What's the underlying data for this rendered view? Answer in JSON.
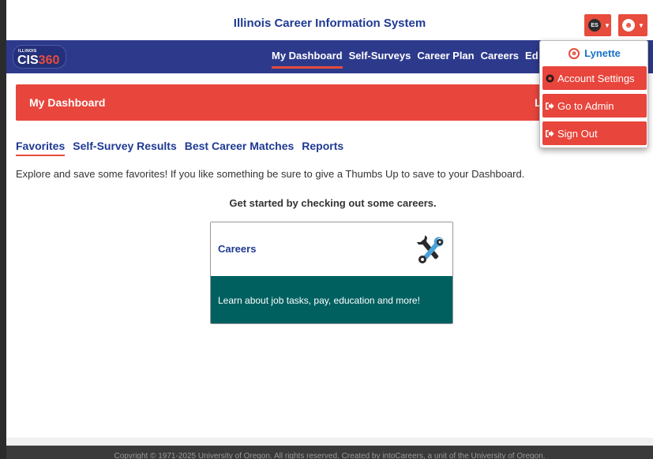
{
  "header": {
    "title": "Illinois Career Information System",
    "lang_badge": "ES",
    "accent_color": "#e74c3c",
    "brand_color": "#2d3a8c"
  },
  "logo": {
    "small_text": "ILLINOIS",
    "brand": "CIS",
    "number": "360"
  },
  "nav": {
    "items": [
      {
        "label": "My Dashboard",
        "active": true
      },
      {
        "label": "Self-Surveys"
      },
      {
        "label": "Career Plan"
      },
      {
        "label": "Careers"
      },
      {
        "label": "Ed"
      }
    ]
  },
  "banner": {
    "title": "My Dashboard",
    "right_text": "L"
  },
  "subtabs": [
    {
      "label": "Favorites",
      "active": true
    },
    {
      "label": "Self-Survey Results"
    },
    {
      "label": "Best Career Matches"
    },
    {
      "label": "Reports"
    }
  ],
  "main": {
    "intro": "Explore and save some favorites! If you like something be sure to give a Thumbs Up to save to your Dashboard.",
    "get_started": "Get started by checking out some careers."
  },
  "card": {
    "title": "Careers",
    "icon": "tools-icon",
    "description": "Learn about job tasks, pay, education and more!",
    "bottom_color": "#006060"
  },
  "user_menu": {
    "name": "Lynette",
    "items": [
      {
        "label": "Account Settings",
        "icon": "gear-icon"
      },
      {
        "label": "Go to Admin",
        "icon": "sign-in-icon"
      },
      {
        "label": "Sign Out",
        "icon": "sign-out-icon"
      }
    ]
  },
  "footer": {
    "copyright": "Copyright © 1971-2025 University of Oregon. All rights reserved. Created by intoCareers, a unit of the University of Oregon."
  }
}
